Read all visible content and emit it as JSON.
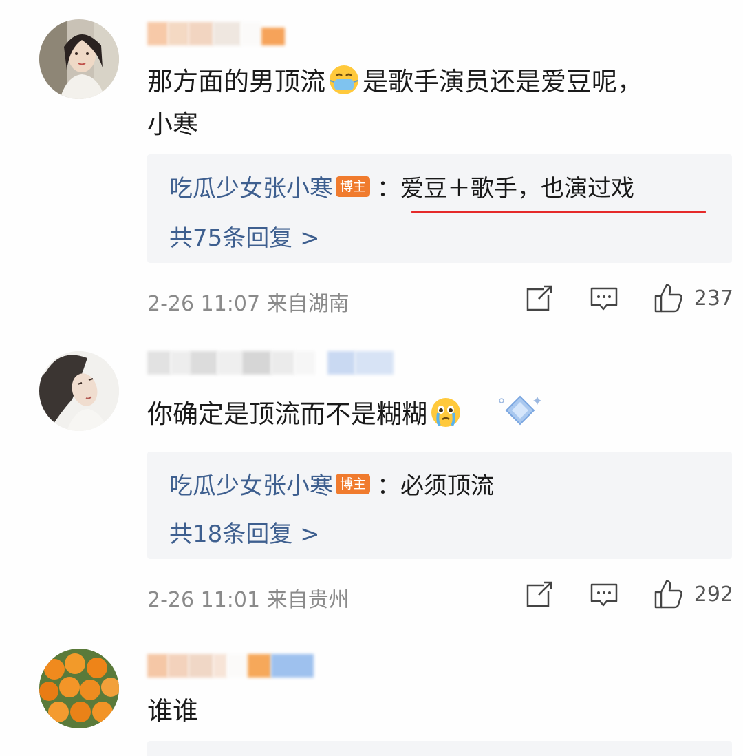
{
  "comments": [
    {
      "text_a": "那方面的男顶流",
      "emoji_a": "mask-face-emoji",
      "text_b": "是歌手演员还是爱豆呢，",
      "text_c": "小寒",
      "reply_author": "吃瓜少女张小寒",
      "reply_badge": "博主",
      "reply_text": "：爱豆＋歌手，也演过戏",
      "reply_count": "共75条回复 >",
      "meta": "2-26 11:07  来自湖南",
      "likes": "237"
    },
    {
      "text_a": "你确定是顶流而不是糊糊",
      "emoji_a": "crying-face-emoji",
      "reply_author": "吃瓜少女张小寒",
      "reply_badge": "博主",
      "reply_text": "：必须顶流",
      "reply_count": "共18条回复 >",
      "meta": "2-26 11:01  来自贵州",
      "likes": "292"
    },
    {
      "text_a": "谁谁"
    }
  ],
  "icons": {
    "share": "share-icon",
    "comment": "comment-icon",
    "like": "thumbs-up-icon"
  },
  "colors": {
    "link_blue": "#3e5f8f",
    "badge_orange": "#f07b2e",
    "highlight_red": "#e52a2a"
  }
}
